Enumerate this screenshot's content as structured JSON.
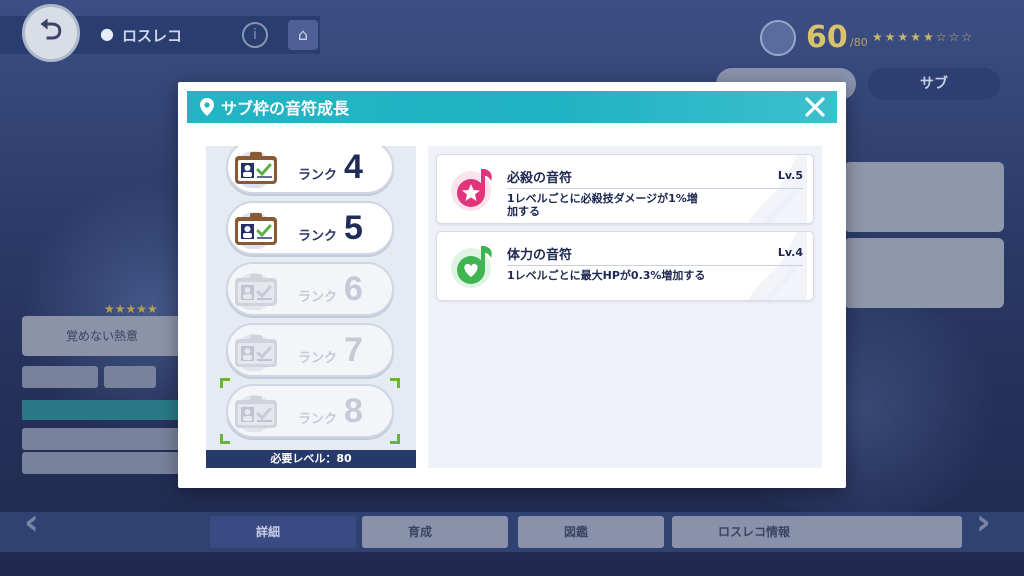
{
  "background": {
    "location_name": "ロスレコ",
    "player_level": "60",
    "player_level_suffix": "/80",
    "sub_tab_label": "サブ",
    "left_panel_text": "覚めない熱意",
    "bottom_tabs": [
      "詳細",
      "育成",
      "図鑑",
      "ロスレコ情報"
    ]
  },
  "dialog": {
    "title": "サブ枠の音符成長",
    "close_icon": "close-x-icon",
    "rank_label_prefix": "ランク",
    "ranks": [
      {
        "rank": "4",
        "unlocked": true
      },
      {
        "rank": "5",
        "unlocked": true
      },
      {
        "rank": "6",
        "unlocked": false
      },
      {
        "rank": "7",
        "unlocked": false
      },
      {
        "rank": "8",
        "unlocked": false,
        "selected": true
      }
    ],
    "required_level_text": "必要レベル：80",
    "notes": [
      {
        "name": "必殺の音符",
        "level": "Lv.5",
        "description": "1レベルごとに必殺技ダメージが1%増加する",
        "icon": "special-note-icon",
        "color": "#e0357a"
      },
      {
        "name": "体力の音符",
        "level": "Lv.4",
        "description": "1レベルごとに最大HPが0.3%増加する",
        "icon": "hp-note-icon",
        "color": "#3fb552"
      }
    ]
  },
  "colors": {
    "header": "#23b5c4",
    "rank_text": "#1f2c5a",
    "locked_text": "#c5cad8",
    "required_bar": "#27386a",
    "selection_corner": "#6ab43a"
  }
}
